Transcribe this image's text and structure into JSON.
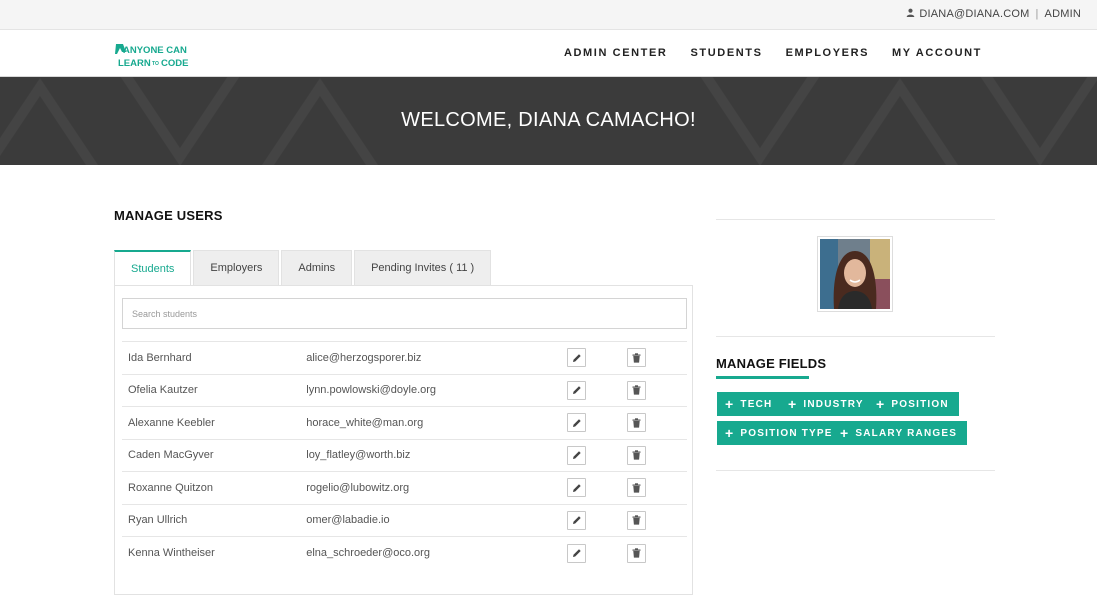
{
  "topbar": {
    "email": "DIANA@DIANA.COM",
    "separator": "|",
    "role_link": "ADMIN",
    "icon": "user-icon"
  },
  "brand": {
    "logo_line1": "ANYONE CAN",
    "logo_line2": "LEARN",
    "logo_to": "TO",
    "logo_line2b": "CODE",
    "color": "#17a98f"
  },
  "nav": {
    "items": [
      "ADMIN CENTER",
      "STUDENTS",
      "EMPLOYERS",
      "MY ACCOUNT"
    ]
  },
  "hero": {
    "title": "WELCOME, DIANA CAMACHO!",
    "background": "#3b3b3b"
  },
  "manage_users": {
    "title": "MANAGE USERS",
    "tabs": [
      "Students",
      "Employers",
      "Admins",
      "Pending Invites ( 11 )"
    ],
    "active_tab": "Students",
    "search_placeholder": "Search students",
    "edit_icon": "pencil-icon",
    "delete_icon": "trash-icon",
    "rows": [
      {
        "name": "Ida Bernhard",
        "email": "alice@herzogsporer.biz"
      },
      {
        "name": "Ofelia Kautzer",
        "email": "lynn.powlowski@doyle.org"
      },
      {
        "name": "Alexanne Keebler",
        "email": "horace_white@man.org"
      },
      {
        "name": "Caden MacGyver",
        "email": "loy_flatley@worth.biz"
      },
      {
        "name": "Roxanne Quitzon",
        "email": "rogelio@lubowitz.org"
      },
      {
        "name": "Ryan Ullrich",
        "email": "omer@labadie.io"
      },
      {
        "name": "Kenna Wintheiser",
        "email": "elna_schroeder@oco.org"
      }
    ]
  },
  "manage_fields": {
    "title": "MANAGE FIELDS",
    "buttons": [
      "TECH",
      "INDUSTRY",
      "POSITION",
      "POSITION TYPE",
      "SALARY RANGES"
    ],
    "accent": "#17a98f"
  }
}
